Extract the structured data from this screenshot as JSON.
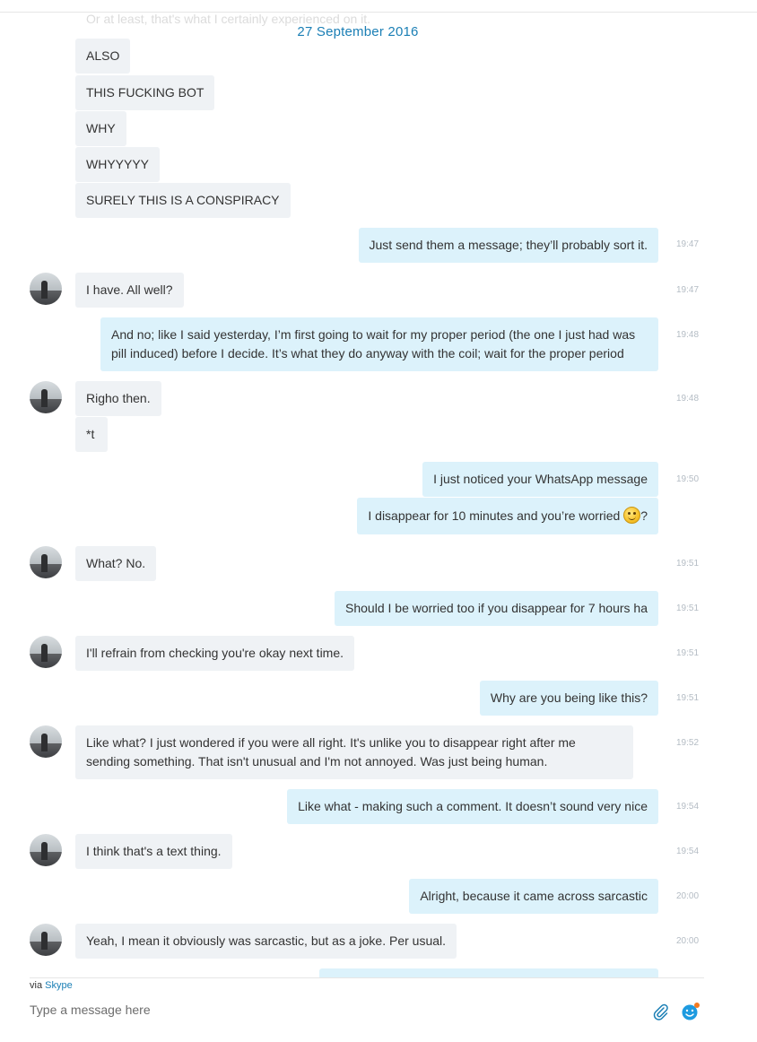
{
  "conversation": {
    "faded_text": "Or at least, that's what I certainly experienced on it.",
    "date_separator": "27 September 2016",
    "messages": [
      {
        "dir": "in",
        "text": "ALSO"
      },
      {
        "dir": "in",
        "text": "THIS FUCKING BOT"
      },
      {
        "dir": "in",
        "text": "WHY"
      },
      {
        "dir": "in",
        "text": "WHYYYYY"
      },
      {
        "dir": "in",
        "text": "SURELY THIS IS A CONSPIRACY"
      },
      {
        "dir": "out",
        "text": "Just send them a message; they’ll probably sort it.",
        "time": "19:47"
      },
      {
        "dir": "in",
        "text": "I have. All well?",
        "time": "19:47"
      },
      {
        "dir": "out",
        "text": "And no; like I said yesterday, I’m first going to wait for my proper period (the one I just had was pill induced) before I decide. It’s what they do anyway with the coil; wait for the proper period",
        "time": "19:48"
      },
      {
        "dir": "in",
        "text": "Righo then.",
        "time": "19:48"
      },
      {
        "dir": "in",
        "text": "*t"
      },
      {
        "dir": "out",
        "text": "I just noticed your WhatsApp message",
        "time": "19:50"
      },
      {
        "dir": "out",
        "text_before": "I disappear for 10 minutes and you’re worried ",
        "emoji": "smile-emoji",
        "text_after": "?"
      },
      {
        "dir": "in",
        "text": "What? No.",
        "time": "19:51"
      },
      {
        "dir": "out",
        "text": "Should I be worried too if you disappear for 7 hours ha",
        "time": "19:51"
      },
      {
        "dir": "in",
        "text": "I'll refrain from checking you're okay next time.",
        "time": "19:51"
      },
      {
        "dir": "out",
        "text": "Why are you being like this?",
        "time": "19:51"
      },
      {
        "dir": "in",
        "text": "Like what? I just wondered if you were all right. It's unlike you to disappear right after me sending something. That isn't unusual and I'm not annoyed. Was just being human.",
        "time": "19:52"
      },
      {
        "dir": "out",
        "text": "Like what - making such a comment. It doesn’t sound very nice",
        "time": "19:54"
      },
      {
        "dir": "in",
        "text": "I think that's a text thing.",
        "time": "19:54"
      },
      {
        "dir": "out",
        "text": "Alright, because it came across sarcastic",
        "time": "20:00"
      },
      {
        "dir": "in",
        "text": "Yeah, I mean it obviously was sarcastic, but as a joke. Per usual.",
        "time": "20:00"
      }
    ]
  },
  "composer": {
    "via_prefix": "via",
    "via_link": "Skype",
    "placeholder": "Type a message here",
    "attach_icon": "paperclip-icon",
    "emoticon_icon": "emoticon-icon"
  },
  "colors": {
    "accent": "#1b7fb5",
    "incoming_bubble": "#eff2f5",
    "outgoing_bubble": "#dcf2fb",
    "timestamp": "#b4bcc4"
  }
}
